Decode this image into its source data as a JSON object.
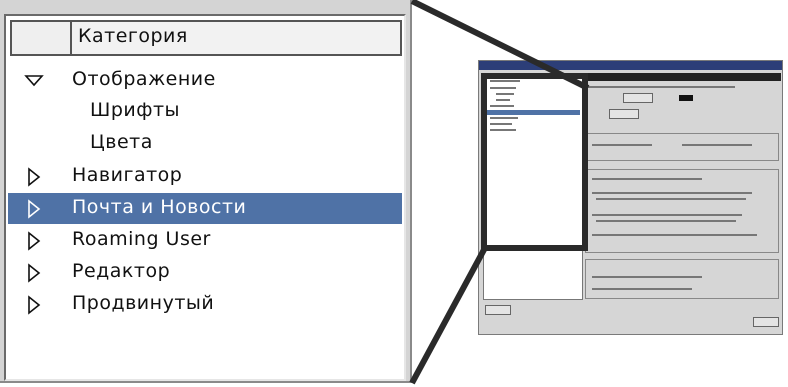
{
  "category_panel": {
    "header": "Категория",
    "items": [
      {
        "label": "Отображение",
        "expanded": true,
        "indent": 0,
        "selected": false
      },
      {
        "label": "Шрифты",
        "expanded": null,
        "indent": 1,
        "selected": false
      },
      {
        "label": "Цвета",
        "expanded": null,
        "indent": 1,
        "selected": false
      },
      {
        "label": "Навигатор",
        "expanded": false,
        "indent": 0,
        "selected": false
      },
      {
        "label": "Почта и Новости",
        "expanded": false,
        "indent": 0,
        "selected": true
      },
      {
        "label": "Roaming User",
        "expanded": false,
        "indent": 0,
        "selected": false
      },
      {
        "label": "Редактор",
        "expanded": false,
        "indent": 0,
        "selected": false
      },
      {
        "label": "Продвинутый",
        "expanded": false,
        "indent": 0,
        "selected": false
      }
    ]
  },
  "colors": {
    "selection": "#4f72a6",
    "panel_bg": "#d4d4d4",
    "connector": "#2a2a2a"
  }
}
